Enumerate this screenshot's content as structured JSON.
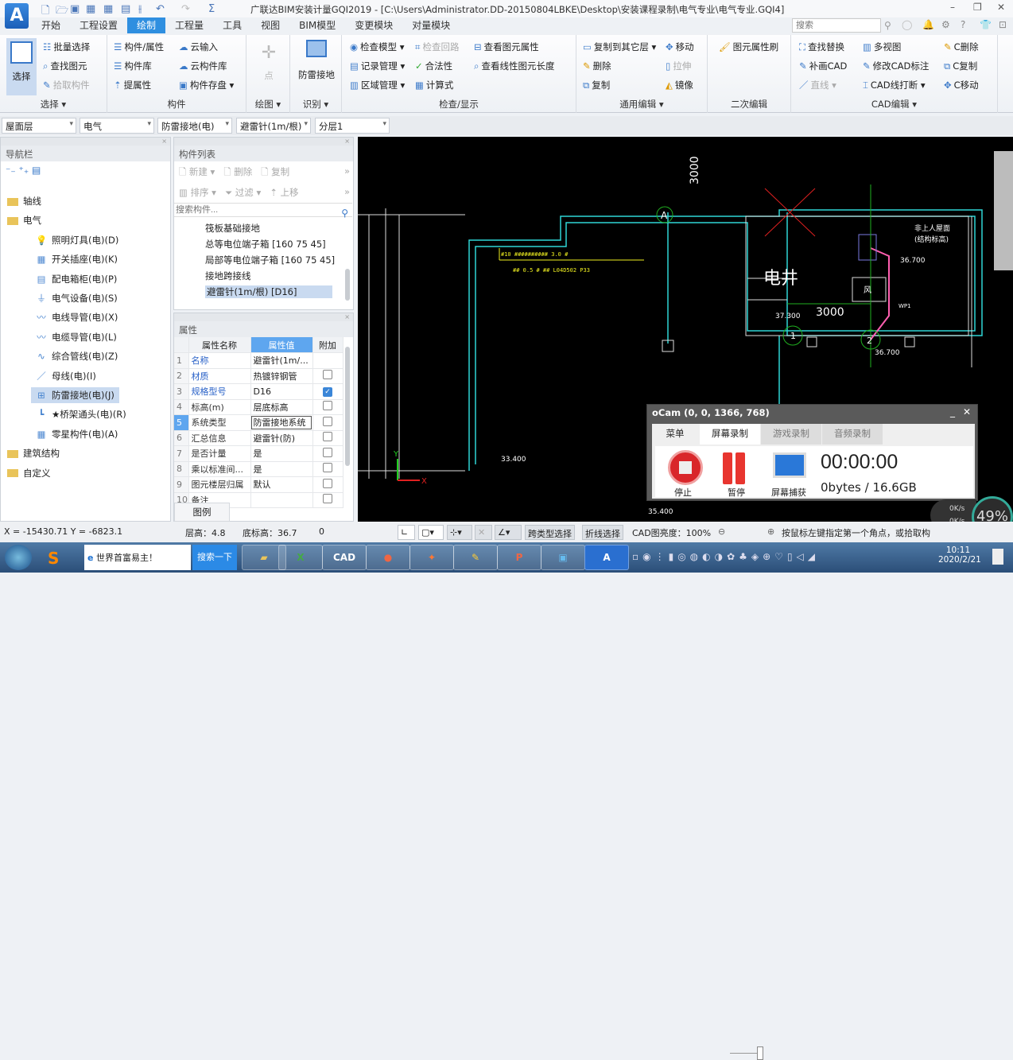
{
  "app": {
    "logo_letter": "A",
    "title": "广联达BIM安装计量GQI2019 - [C:\\Users\\Administrator.DD-20150804LBKE\\Desktop\\安装课程录制\\电气专业\\电气专业.GQI4]",
    "quick_access": [
      "new-icon",
      "open-icon",
      "save-icon",
      "report-icon",
      "bim-icon",
      "export-icon",
      "split-icon",
      "undo-icon",
      "redo-icon",
      "sum-icon"
    ],
    "minimize": "–",
    "restore": "❐",
    "close": "✕",
    "search_placeholder": "搜索"
  },
  "tabs": [
    {
      "label": "开始"
    },
    {
      "label": "工程设置"
    },
    {
      "label": "绘制",
      "active": true
    },
    {
      "label": "工程量"
    },
    {
      "label": "工具"
    },
    {
      "label": "视图"
    },
    {
      "label": "BIM模型"
    },
    {
      "label": "变更模块"
    },
    {
      "label": "对量模块"
    }
  ],
  "ribbon": {
    "select": {
      "big": "选择",
      "items": [
        "批量选择",
        "查找图元",
        "拾取构件"
      ],
      "label": "选择"
    },
    "component": {
      "items": [
        "构件/属性",
        "构件库",
        "提属性",
        "云输入",
        "云构件库",
        "构件存盘"
      ],
      "label": "构件"
    },
    "draw": {
      "big": "点",
      "label": "绘图"
    },
    "identify": {
      "big": "防雷接地",
      "label": "识别"
    },
    "check": {
      "items": [
        "检查模型",
        "记录管理",
        "区域管理",
        "检查回路",
        "合法性",
        "计算式",
        "查看图元属性",
        "查看线性图元长度"
      ],
      "label": "检查/显示"
    },
    "edit": {
      "items": [
        "复制到其它层",
        "删除",
        "复制",
        "移动",
        "拉伸",
        "镜像"
      ],
      "label": "通用编辑"
    },
    "secondary": {
      "items": [
        "图元属性刷"
      ],
      "label": "二次编辑"
    },
    "cad": {
      "items": [
        "查找替换",
        "补画CAD",
        "直线",
        "多视图",
        "修改CAD标注",
        "CAD线打断",
        "C删除",
        "C复制",
        "C移动"
      ],
      "label": "CAD编辑"
    }
  },
  "filters": [
    "屋面层",
    "电气",
    "防雷接地(电)",
    "避雷针(1m/根)",
    "分层1"
  ],
  "nav": {
    "title": "导航栏",
    "items": [
      {
        "label": "轴线",
        "folder": true
      },
      {
        "label": "电气",
        "folder": true
      },
      {
        "label": "照明灯具(电)(D)",
        "icon": "💡"
      },
      {
        "label": "开关插座(电)(K)",
        "icon": "▦"
      },
      {
        "label": "配电箱柜(电)(P)",
        "icon": "▤"
      },
      {
        "label": "电气设备(电)(S)",
        "icon": "⏚"
      },
      {
        "label": "电线导管(电)(X)",
        "icon": "〰"
      },
      {
        "label": "电缆导管(电)(L)",
        "icon": "〰"
      },
      {
        "label": "综合管线(电)(Z)",
        "icon": "∿"
      },
      {
        "label": "母线(电)(I)",
        "icon": "／"
      },
      {
        "label": "防雷接地(电)(J)",
        "icon": "⊞",
        "selected": true
      },
      {
        "label": "★桥架通头(电)(R)",
        "icon": "┗"
      },
      {
        "label": "零星构件(电)(A)",
        "icon": "▦"
      },
      {
        "label": "建筑结构",
        "folder": true
      },
      {
        "label": "自定义",
        "folder": true
      }
    ]
  },
  "component_list": {
    "title": "构件列表",
    "toolbar1": [
      "新建",
      "删除",
      "复制"
    ],
    "toolbar2": [
      "排序",
      "过滤",
      "上移"
    ],
    "search_placeholder": "搜索构件...",
    "items": [
      "筏板基础接地",
      "总等电位端子箱 [160 75 45]",
      "局部等电位端子箱 [160 75 45]",
      "接地跨接线",
      "避雷针(1m/根) [D16]"
    ],
    "selected": 4
  },
  "properties": {
    "title": "属性",
    "headers": [
      "属性名称",
      "属性值",
      "附加"
    ],
    "rows": [
      {
        "n": "1",
        "name": "名称",
        "value": "避雷针(1m/...",
        "blue": true,
        "check": null
      },
      {
        "n": "2",
        "name": "材质",
        "value": "热镀锌钢管",
        "blue": true,
        "check": false
      },
      {
        "n": "3",
        "name": "规格型号",
        "value": "D16",
        "blue": true,
        "check": true
      },
      {
        "n": "4",
        "name": "标高(m)",
        "value": "层底标高",
        "check": false
      },
      {
        "n": "5",
        "name": "系统类型",
        "value": "防雷接地系统",
        "check": false,
        "active": true
      },
      {
        "n": "6",
        "name": "汇总信息",
        "value": "避雷针(防)",
        "check": false
      },
      {
        "n": "7",
        "name": "是否计量",
        "value": "是",
        "check": false
      },
      {
        "n": "8",
        "name": "乘以标准间...",
        "value": "是",
        "check": false
      },
      {
        "n": "9",
        "name": "图元楼层归属",
        "value": "默认",
        "check": false
      },
      {
        "n": "10",
        "name": "备注",
        "value": "",
        "check": false
      }
    ],
    "legend_tab": "图例"
  },
  "cad": {
    "texts": {
      "dim1": "3000",
      "axisA": "A",
      "room": "电井",
      "dim2": "3000",
      "lvl1": "37.300",
      "lvl2": "36.700",
      "lvl3": "36.700",
      "lvl4": "33.400",
      "lvl5": "35.400",
      "axis1": "1",
      "axis2": "2",
      "note1": "非上人屋面",
      "note2": "(结构标高)",
      "wp": "WP1",
      "yel1": "#10  ########## 3.0  #",
      "yel2": "##  0.5 #  ##  L04D502  P33",
      "fan": "风"
    },
    "colors": {
      "cyan": "#2fd6d6",
      "pink": "#ff5fb0",
      "yellow": "#f0f020",
      "green": "#20b020",
      "red": "#e02020"
    }
  },
  "status": {
    "coords": "X = -15430.71 Y = -6823.1",
    "floor_height": "层高：4.8",
    "base_height": "底标高：36.7",
    "zero": "0",
    "btn_cross": "跨类型选择",
    "btn_polyline": "折线选择",
    "brightness": "CAD图亮度：100%",
    "brightness_value": 100,
    "hint": "按鼠标左键指定第一个角点，或拾取构件图元"
  },
  "ocam": {
    "title": "oCam (0, 0, 1366, 768)",
    "tabs": [
      "菜单",
      "屏幕录制",
      "游戏录制",
      "音频录制"
    ],
    "active_tab": 1,
    "stop": "停止",
    "pause": "暂停",
    "capture": "屏幕捕获",
    "time": "00:00:00",
    "size": "0bytes / 16.6GB"
  },
  "netmon": {
    "up": "0K/s",
    "down": "0K/s",
    "percent": "49%"
  },
  "taskbar": {
    "browser_text": "世界首富易主！",
    "search_btn": "搜索一下",
    "apps": [
      "folder",
      "excel",
      "cad",
      "ppt-o",
      "pdf",
      "notes",
      "powerpoint",
      "screen",
      "glodon"
    ],
    "app_labels": {
      "cad": "CAD",
      "glodon": "A"
    },
    "time": "10:11",
    "date": "2020/2/21"
  }
}
